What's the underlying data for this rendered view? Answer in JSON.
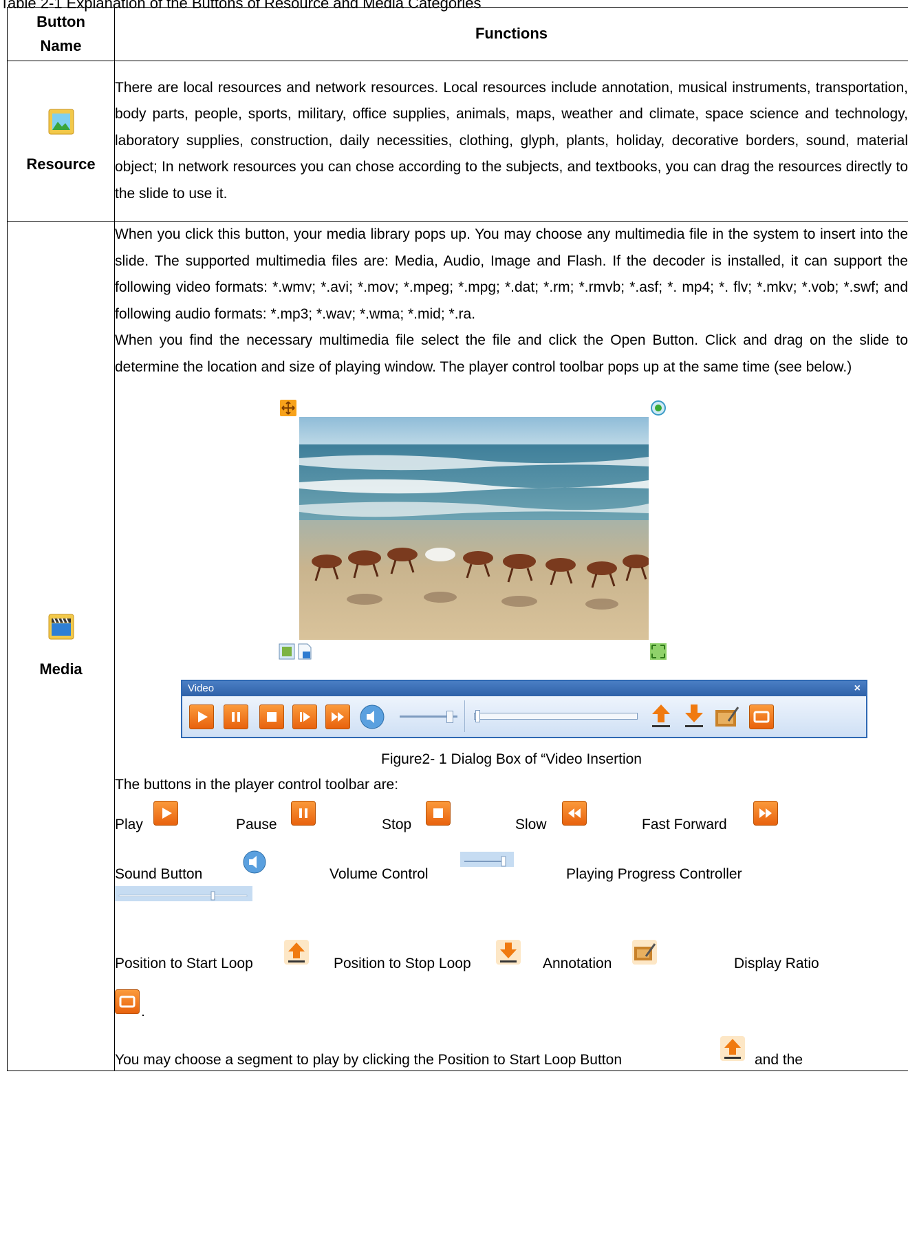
{
  "top_caption": "Table 2-1 Explanation of the Buttons of Resource and Media Categories",
  "header": {
    "col1": "Button Name",
    "col1_line1": "Button",
    "col1_line2": "Name",
    "col2": "Functions"
  },
  "rows": [
    {
      "name": "Resource",
      "icon": "picture-icon",
      "text": "There are local resources and network resources. Local resources include annotation, musical instruments, transportation, body parts, people, sports, military, office supplies, animals, maps, weather and climate, space science and technology, laboratory supplies, construction, daily necessities, clothing, glyph, plants, holiday, decorative borders, sound, material object; In network resources you can chose according to the subjects, and textbooks, you can drag the resources directly to the slide to use it."
    },
    {
      "name": "Media",
      "icon": "clapperboard-icon",
      "para1": "When you click this button, your media library pops up.   You may choose any multimedia file in the system to insert into the slide. The supported multimedia files are: Media, Audio, Image and Flash. If the decoder is installed, it can support the following video formats: *.wmv; *.avi; *.mov; *.mpeg; *.mpg; *.dat; *.rm; *.rmvb; *.asf; *. mp4; *. flv; *.mkv; *.vob; *.swf; and following audio formats: *.mp3; *.wav; *.wma; *.mid; *.ra.",
      "para2": "When you find the necessary multimedia file select the file and click the Open Button. Click and drag on the slide to determine the location and size of playing window. The player control toolbar pops up at the same time (see below.)",
      "toolbar_title": "Video",
      "toolbar_close": "×",
      "figure_caption": "Figure2- 1 Dialog Box of “Video Insertion",
      "buttons_intro": "The buttons in the player control toolbar are:",
      "buttons": {
        "play": "Play",
        "pause": "Pause",
        "stop": "Stop",
        "slow": "Slow",
        "fast_forward": "Fast  Forward",
        "sound": "Sound   Button",
        "volume": "Volume   Control",
        "progress": "Playing   Progress   Controller",
        "start_loop": "Position to Start Loop",
        "stop_loop": "Position to Stop Loop",
        "annotation": "Annotation",
        "display_ratio": "Display Ratio"
      },
      "trailing_period": ".",
      "last_line_a": "You may choose a segment to play by clicking the Position to Start Loop Button",
      "last_line_b": "and the"
    }
  ]
}
